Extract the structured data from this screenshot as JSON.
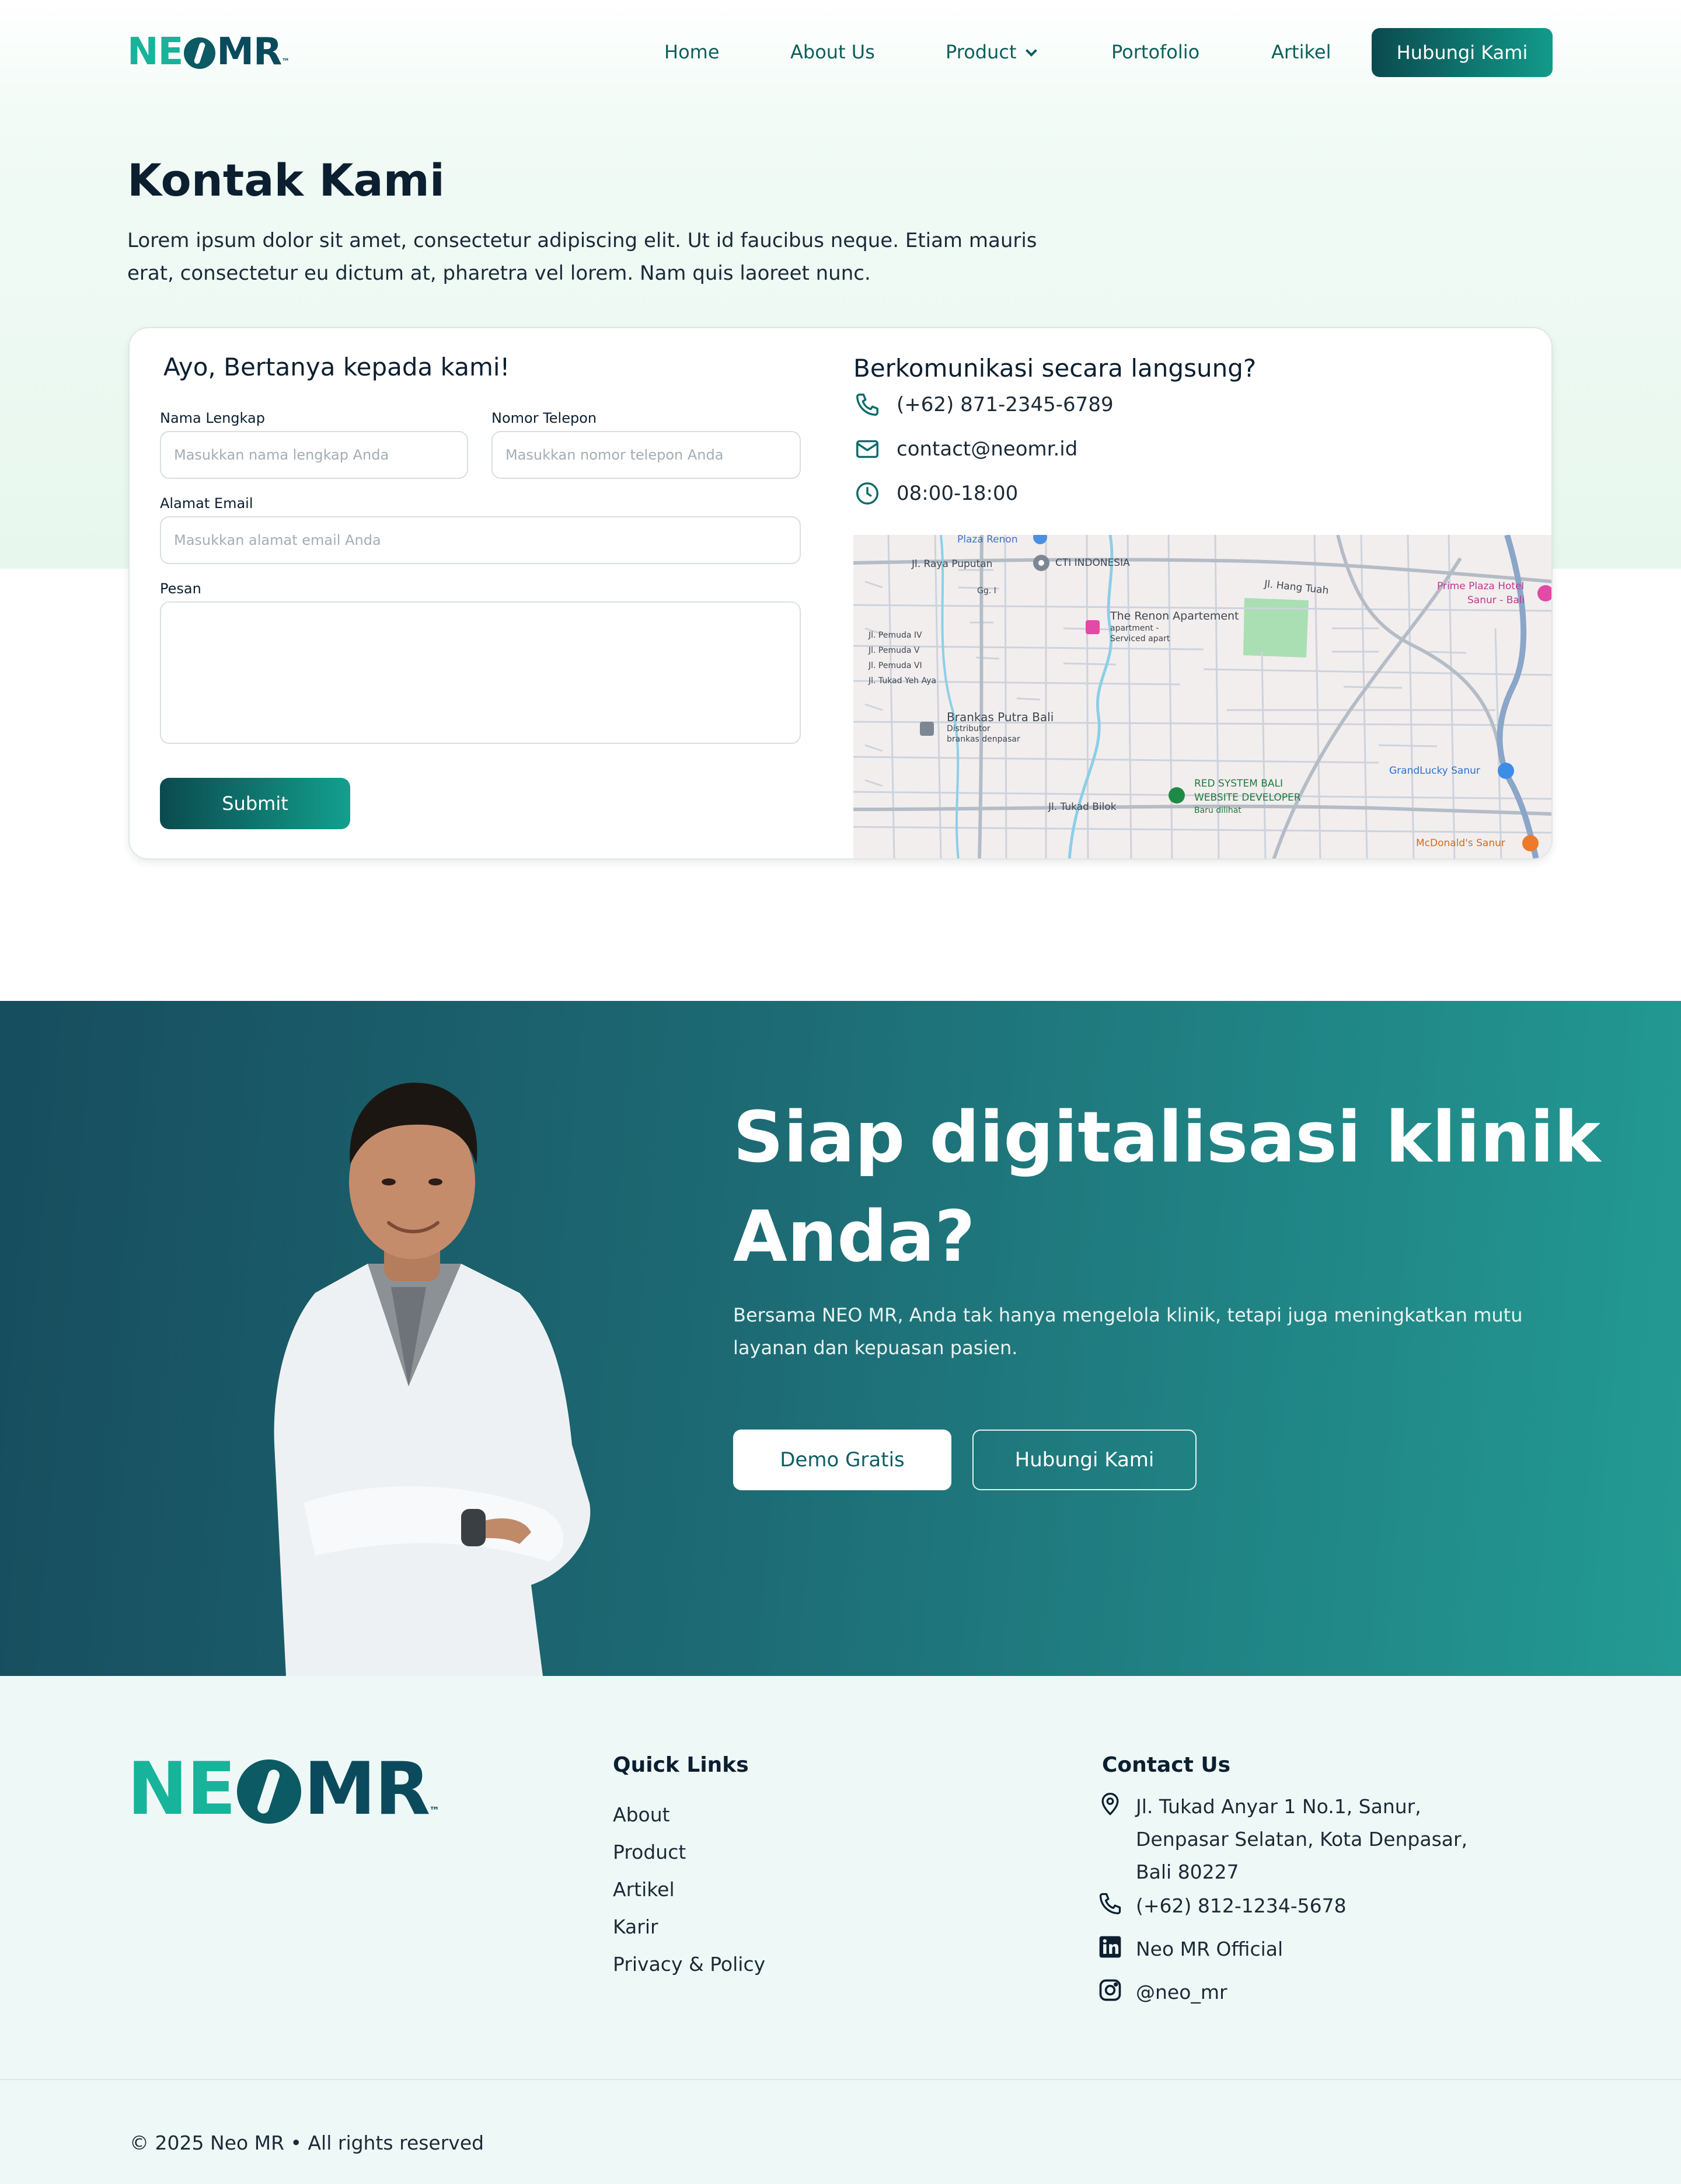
{
  "brand": {
    "logo_left": "NE",
    "logo_right": "MR",
    "logo_tm": "™"
  },
  "nav": {
    "items": [
      "Home",
      "About Us",
      "Product",
      "Portofolio",
      "Artikel"
    ],
    "cta": "Hubungi Kami"
  },
  "contact": {
    "title": "Kontak Kami",
    "description": "Lorem ipsum dolor sit amet, consectetur adipiscing elit. Ut id faucibus neque. Etiam mauris erat, consectetur eu dictum at, pharetra vel lorem. Nam quis laoreet nunc.",
    "form": {
      "title": "Ayo, Bertanya kepada kami!",
      "name_label": "Nama Lengkap",
      "name_placeholder": "Masukkan nama lengkap Anda",
      "phone_label": "Nomor Telepon",
      "phone_placeholder": "Masukkan nomor telepon Anda",
      "email_label": "Alamat Email",
      "email_placeholder": "Masukkan alamat email Anda",
      "message_label": "Pesan",
      "submit": "Submit"
    },
    "direct": {
      "title": "Berkomunikasi secara langsung?",
      "phone": "(+62) 871-2345-6789",
      "email": "contact@neomr.id",
      "hours": "08:00-18:00"
    },
    "map_labels": {
      "plaza_renon": "Plaza Renon",
      "raya_puputan": "Jl. Raya Puputan",
      "cti": "CTI INDONESIA",
      "hang_tuah": "Jl. Hang Tuah",
      "prime_plaza": "Prime Plaza Hotel",
      "prime_plaza_2": "Sanur - Bali",
      "renon_apt": "The Renon Apartement",
      "renon_apt_2": "apartment -",
      "renon_apt_3": "Serviced apart",
      "pemuda_iv": "Jl. Pemuda IV",
      "pemuda_v": "Jl. Pemuda V",
      "pemuda_vi": "Jl. Pemuda VI",
      "tukad_yeh_aya": "Jl. Tukad Yeh Aya",
      "brankas": "Brankas Putra Bali",
      "brankas_2": "Distributor",
      "brankas_3": "brankas denpasar",
      "red_system": "RED SYSTEM BALI",
      "red_system_2": "WEBSITE DEVELOPER",
      "red_system_3": "Baru dilihat",
      "grandlucky": "GrandLucky Sanur",
      "tukad_bilok": "Jl. Tukad Bilok",
      "mcdonalds": "McDonald's Sanur",
      "gg_i": "Gg. I"
    }
  },
  "cta": {
    "title": "Siap digitalisasi klinik Anda?",
    "description": "Bersama NEO MR, Anda tak hanya mengelola klinik, tetapi juga meningkatkan mutu layanan dan kepuasan pasien.",
    "primary": "Demo Gratis",
    "secondary": "Hubungi Kami"
  },
  "footer": {
    "quick_links_title": "Quick Links",
    "links": [
      "About",
      "Product",
      "Artikel",
      "Karir",
      "Privacy & Policy"
    ],
    "contact_title": "Contact Us",
    "address": "Jl. Tukad Anyar 1 No.1, Sanur, Denpasar Selatan, Kota Denpasar, Bali 80227",
    "phone": "(+62) 812-1234-5678",
    "linkedin": "Neo MR Official",
    "instagram": "@neo_mr",
    "copyright": "© 2025 Neo MR • All rights reserved"
  },
  "colors": {
    "brand_teal": "#17b39a",
    "brand_dark": "#0b4a5c",
    "cta_gradient_start": "#174d5e",
    "cta_gradient_end": "#239a93"
  }
}
